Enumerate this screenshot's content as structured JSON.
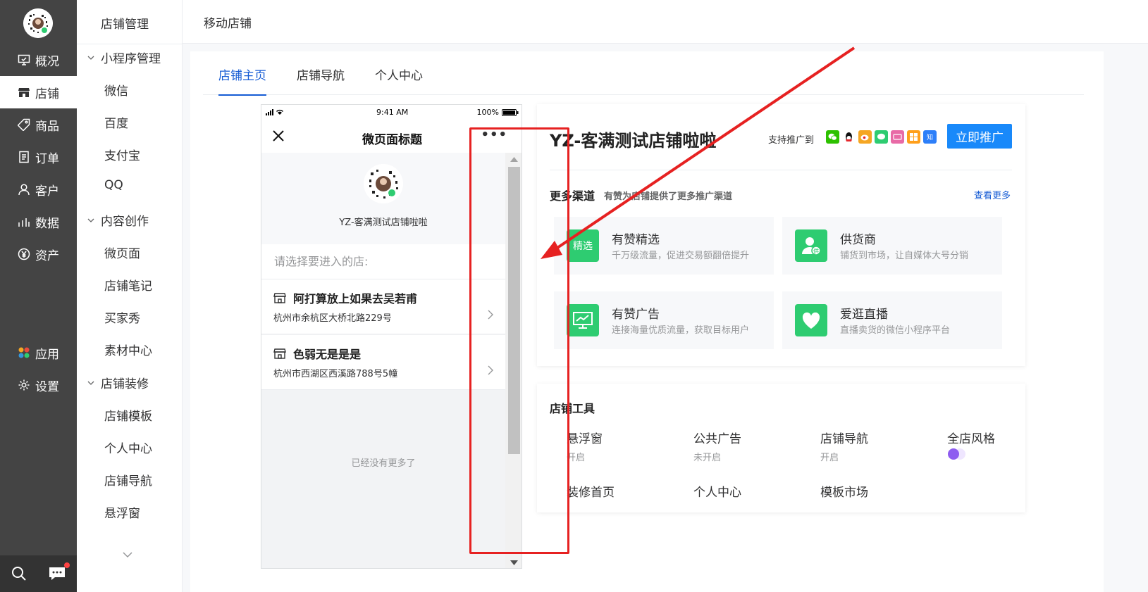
{
  "leftnav": {
    "items": [
      {
        "label": "概况",
        "icon": "monitor-icon"
      },
      {
        "label": "店铺",
        "icon": "store-icon"
      },
      {
        "label": "商品",
        "icon": "tag-icon"
      },
      {
        "label": "订单",
        "icon": "order-icon"
      },
      {
        "label": "客户",
        "icon": "user-icon"
      },
      {
        "label": "数据",
        "icon": "bar-chart-icon"
      },
      {
        "label": "资产",
        "icon": "yen-icon"
      },
      {
        "label": "应用",
        "icon": "apps-icon"
      },
      {
        "label": "设置",
        "icon": "gear-icon"
      }
    ],
    "active": "店铺"
  },
  "subnav": {
    "title": "店铺管理",
    "groups": [
      {
        "label": "小程序管理",
        "items": [
          "微信",
          "百度",
          "支付宝",
          "QQ"
        ]
      },
      {
        "label": "内容创作",
        "items": [
          "微页面",
          "店铺笔记",
          "买家秀",
          "素材中心"
        ]
      },
      {
        "label": "店铺装修",
        "items": [
          "店铺模板",
          "个人中心",
          "店铺导航",
          "悬浮窗"
        ]
      }
    ]
  },
  "topbar": {
    "breadcrumb": "移动店铺"
  },
  "tabs": [
    "店铺主页",
    "店铺导航",
    "个人中心"
  ],
  "phone": {
    "time": "9:41 AM",
    "battery": "100%",
    "page_title": "微页面标题",
    "more": "•••",
    "shop_name": "YZ-客满测试店铺啦啦",
    "choose_label": "请选择要进入的店:",
    "stores": [
      {
        "name": "阿打算放上如果去吴若甫",
        "address": "杭州市余杭区大桥北路229号"
      },
      {
        "name": "色弱无是是是",
        "address": "杭州市西湖区西溪路788号5幢"
      }
    ],
    "end_text": "已经没有更多了"
  },
  "shop_card": {
    "title": "YZ-客满测试店铺啦啦",
    "support_label": "支持推广到",
    "channels": [
      {
        "name": "wechat-icon",
        "color": "#2dc100",
        "text": ""
      },
      {
        "name": "qq-icon",
        "color": "#ffffff",
        "text": ""
      },
      {
        "name": "weibo-icon",
        "color": "#f5a623",
        "text": ""
      },
      {
        "name": "message-icon",
        "color": "#2ecc71",
        "text": ""
      },
      {
        "name": "live-icon",
        "color": "#e86aa6",
        "text": ""
      },
      {
        "name": "baidu-icon",
        "color": "#ff9f1a",
        "text": ""
      },
      {
        "name": "zhihu-icon",
        "color": "#2d7ff9",
        "text": "知"
      }
    ],
    "promote_button": "立即推广",
    "more_title": "更多渠道",
    "more_sub": "有赞为店铺提供了更多推广渠道",
    "more_link": "查看更多",
    "tiles": [
      {
        "name": "有赞精选",
        "desc": "千万级流量，促进交易额翻倍提升",
        "icon_text": "精选"
      },
      {
        "name": "供货商",
        "desc": "铺货到市场，让自媒体大号分销",
        "icon_text": "供"
      },
      {
        "name": "有赞广告",
        "desc": "连接海量优质流量，获取目标用户",
        "icon_text": ""
      },
      {
        "name": "爱逛直播",
        "desc": "直播卖货的微信小程序平台",
        "icon_text": ""
      }
    ]
  },
  "tools_card": {
    "title": "店铺工具",
    "tools": [
      {
        "name": "悬浮窗",
        "status": "开启"
      },
      {
        "name": "公共广告",
        "status": "未开启"
      },
      {
        "name": "店铺导航",
        "status": "开启"
      },
      {
        "name": "全店风格",
        "status": ""
      },
      {
        "name": "装修首页",
        "status": ""
      },
      {
        "name": "个人中心",
        "status": ""
      },
      {
        "name": "模板市场",
        "status": ""
      }
    ],
    "style_colors": [
      "#8e5cf0",
      "#efe6ff"
    ]
  },
  "colors": {
    "accent": "#155bd4",
    "button": "#1989fa",
    "annotation": "#e62121",
    "green": "#2ecc71"
  }
}
